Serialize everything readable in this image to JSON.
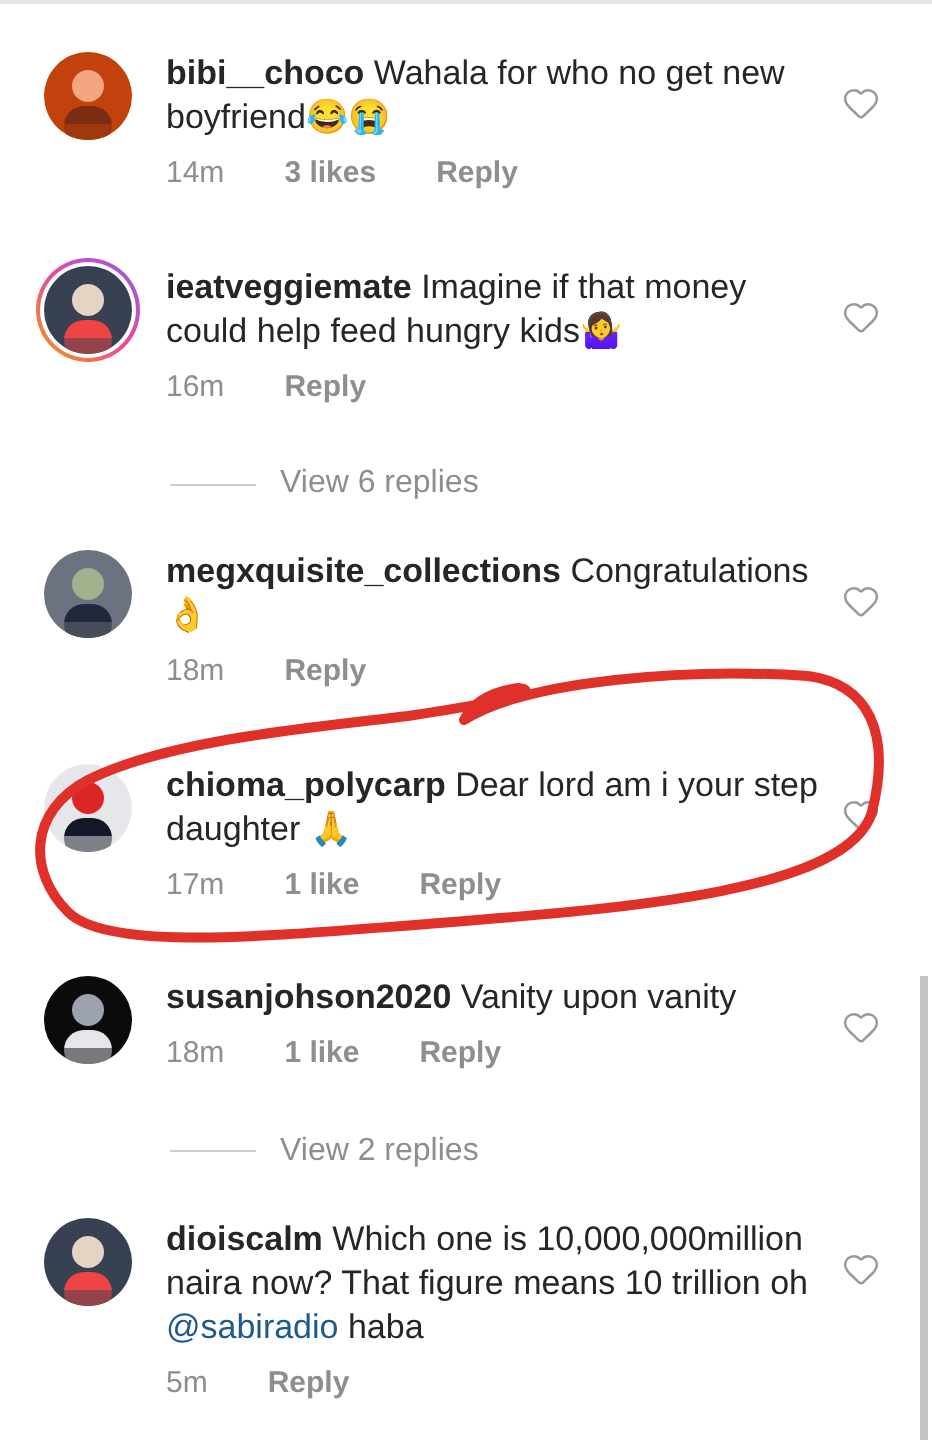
{
  "comments": [
    {
      "kind": "comment",
      "avatar": {
        "story_ring": false
      },
      "user": "bibi__choco",
      "body": [
        {
          "kind": "text",
          "text": "Wahala for who no get new boyfriend😂😭"
        }
      ],
      "time": "14m",
      "likes": "3 likes",
      "reply": "Reply"
    },
    {
      "kind": "comment",
      "avatar": {
        "story_ring": true
      },
      "user": "ieatveggiemate",
      "body": [
        {
          "kind": "text",
          "text": "Imagine if that money could help feed hungry kids🤷‍♀️"
        }
      ],
      "time": "16m",
      "reply": "Reply"
    },
    {
      "kind": "replies",
      "label": "View 6 replies"
    },
    {
      "kind": "comment",
      "avatar": {
        "story_ring": false
      },
      "user": "megxquisite_collections",
      "body": [
        {
          "kind": "text",
          "text": "Congratulations👌"
        }
      ],
      "time": "18m",
      "reply": "Reply"
    },
    {
      "kind": "comment",
      "avatar": {
        "story_ring": false
      },
      "user": "chioma_polycarp",
      "body": [
        {
          "kind": "text",
          "text": "Dear lord am i your step daughter 🙏"
        }
      ],
      "time": "17m",
      "likes": "1 like",
      "reply": "Reply"
    },
    {
      "kind": "comment",
      "avatar": {
        "story_ring": false
      },
      "user": "susanjohson2020",
      "body": [
        {
          "kind": "text",
          "text": "Vanity upon vanity"
        }
      ],
      "time": "18m",
      "likes": "1 like",
      "reply": "Reply"
    },
    {
      "kind": "replies",
      "label": "View 2 replies"
    },
    {
      "kind": "comment",
      "avatar": {
        "story_ring": false
      },
      "user": "dioiscalm",
      "body": [
        {
          "kind": "text",
          "text": "Which one is 10,000,000million naira now? That figure means 10 trillion oh "
        },
        {
          "kind": "mention",
          "text": "@sabiradio"
        },
        {
          "kind": "text",
          "text": " haba"
        }
      ],
      "time": "5m",
      "reply": "Reply"
    }
  ]
}
